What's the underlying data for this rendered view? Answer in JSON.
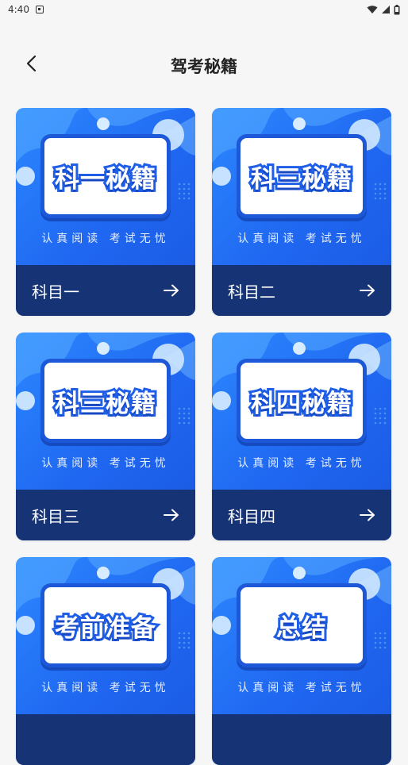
{
  "status_bar": {
    "time": "4:40"
  },
  "header": {
    "title": "驾考秘籍"
  },
  "cards": [
    {
      "board_title": "科一秘籍",
      "tagline": "认真阅读 考试无忧",
      "label": "科目一"
    },
    {
      "board_title": "科三秘籍",
      "tagline": "认真阅读 考试无忧",
      "label": "科目二"
    },
    {
      "board_title": "科三秘籍",
      "tagline": "认真阅读 考试无忧",
      "label": "科目三"
    },
    {
      "board_title": "科四秘籍",
      "tagline": "认真阅读 考试无忧",
      "label": "科目四"
    },
    {
      "board_title": "考前准备",
      "tagline": "认真阅读 考试无忧",
      "label": ""
    },
    {
      "board_title": "总结",
      "tagline": "认真阅读 考试无忧",
      "label": ""
    }
  ],
  "colors": {
    "card_blue": "#2c88ff",
    "footer_navy": "#163375",
    "background": "#f6f6f7"
  }
}
